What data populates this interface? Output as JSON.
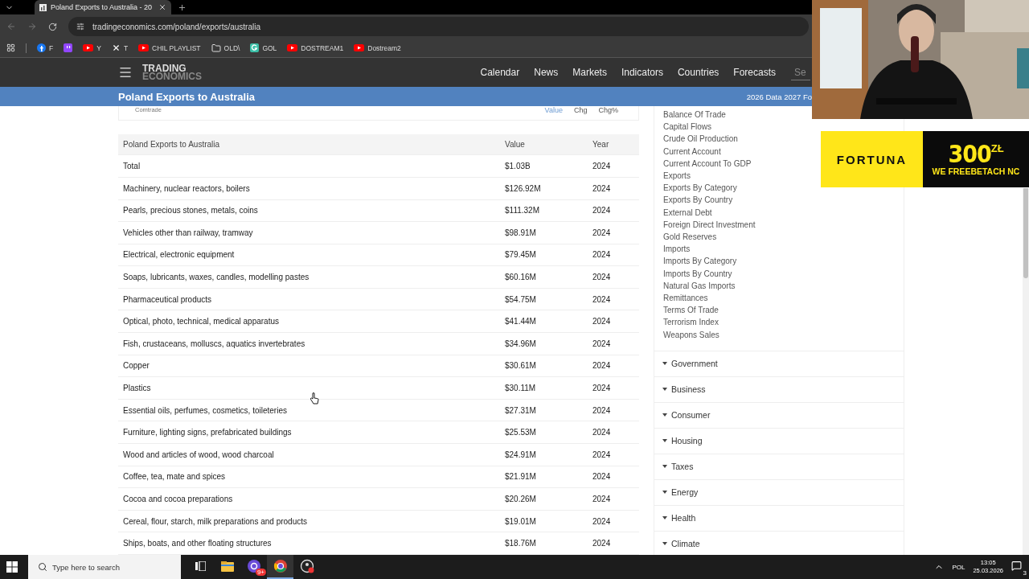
{
  "browser": {
    "tab": {
      "title": "Poland Exports to Australia - 20"
    },
    "url": "tradingeconomics.com/poland/exports/australia",
    "bookmarks": [
      {
        "kind": "facebook",
        "label": "F"
      },
      {
        "kind": "twitch"
      },
      {
        "kind": "youtube",
        "label": "Y"
      },
      {
        "kind": "x",
        "label": "T"
      },
      {
        "kind": "youtube",
        "label": "CHIL PLAYLIST"
      },
      {
        "kind": "folder",
        "label": "OLD\\"
      },
      {
        "kind": "g",
        "label": "GOL"
      },
      {
        "kind": "youtube",
        "label": "DOSTREAM1"
      },
      {
        "kind": "youtube",
        "label": "Dostream2"
      }
    ]
  },
  "site": {
    "logo": {
      "line_1": "TRADING",
      "line_2": "ECONOMICS"
    },
    "nav": [
      "Calendar",
      "News",
      "Markets",
      "Indicators",
      "Countries",
      "Forecasts"
    ],
    "search": {
      "placeholder": "Se"
    }
  },
  "title_bar": {
    "title": "Poland Exports to Australia",
    "notice": "2026 Data 2027 Fo"
  },
  "source_card": {
    "source": "Comtrade",
    "tabs": [
      {
        "label": "Value",
        "selected": true
      },
      {
        "label": "Chg",
        "selected": false
      },
      {
        "label": "Chg%",
        "selected": false
      }
    ]
  },
  "table": {
    "columns": [
      "Poland Exports to Australia",
      "Value",
      "Year"
    ],
    "rows": [
      [
        "Total",
        "$1.03B",
        "2024"
      ],
      [
        "Machinery, nuclear reactors, boilers",
        "$126.92M",
        "2024"
      ],
      [
        "Pearls, precious stones, metals, coins",
        "$111.32M",
        "2024"
      ],
      [
        "Vehicles other than railway, tramway",
        "$98.91M",
        "2024"
      ],
      [
        "Electrical, electronic equipment",
        "$79.45M",
        "2024"
      ],
      [
        "Soaps, lubricants, waxes, candles, modelling pastes",
        "$60.16M",
        "2024"
      ],
      [
        "Pharmaceutical products",
        "$54.75M",
        "2024"
      ],
      [
        "Optical, photo, technical, medical apparatus",
        "$41.44M",
        "2024"
      ],
      [
        "Fish, crustaceans, molluscs, aquatics invertebrates",
        "$34.96M",
        "2024"
      ],
      [
        "Copper",
        "$30.61M",
        "2024"
      ],
      [
        "Plastics",
        "$30.11M",
        "2024"
      ],
      [
        "Essential oils, perfumes, cosmetics, toileteries",
        "$27.31M",
        "2024"
      ],
      [
        "Furniture, lighting signs, prefabricated buildings",
        "$25.53M",
        "2024"
      ],
      [
        "Wood and articles of wood, wood charcoal",
        "$24.91M",
        "2024"
      ],
      [
        "Coffee, tea, mate and spices",
        "$21.91M",
        "2024"
      ],
      [
        "Cocoa and cocoa preparations",
        "$20.26M",
        "2024"
      ],
      [
        "Cereal, flour, starch, milk preparations and products",
        "$19.01M",
        "2024"
      ],
      [
        "Ships, boats, and other floating structures",
        "$18.76M",
        "2024"
      ]
    ]
  },
  "sidebar": {
    "links": [
      "Balance Of Trade",
      "Capital Flows",
      "Crude Oil Production",
      "Current Account",
      "Current Account To GDP",
      "Exports",
      "Exports By Category",
      "Exports By Country",
      "External Debt",
      "Foreign Direct Investment",
      "Gold Reserves",
      "Imports",
      "Imports By Category",
      "Imports By Country",
      "Natural Gas Imports",
      "Remittances",
      "Terms Of Trade",
      "Terrorism Index",
      "Weapons Sales"
    ],
    "sections": [
      {
        "label": "Government",
        "expanded": false
      },
      {
        "label": "Business",
        "expanded": false
      },
      {
        "label": "Consumer",
        "expanded": false
      },
      {
        "label": "Housing",
        "expanded": false
      },
      {
        "label": "Taxes",
        "expanded": false
      },
      {
        "label": "Energy",
        "expanded": false
      },
      {
        "label": "Health",
        "expanded": false
      },
      {
        "label": "Climate",
        "expanded": false
      }
    ]
  },
  "ad": {
    "brand": "FORTUNA",
    "amount": "300",
    "currency": "ZŁ",
    "tagline": "WE FREEBETACH NC"
  },
  "taskbar": {
    "search": {
      "placeholder": "Type here to search"
    },
    "apps": [
      {
        "kind": "taskview",
        "active": false
      },
      {
        "kind": "explorer",
        "active": false
      },
      {
        "kind": "messenger",
        "active": false,
        "badge": "9+"
      },
      {
        "kind": "chrome",
        "active": true
      },
      {
        "kind": "obs",
        "active": false
      }
    ],
    "language": "POL",
    "time": "13:05",
    "date": "25.03.2026",
    "notifications": "3"
  }
}
